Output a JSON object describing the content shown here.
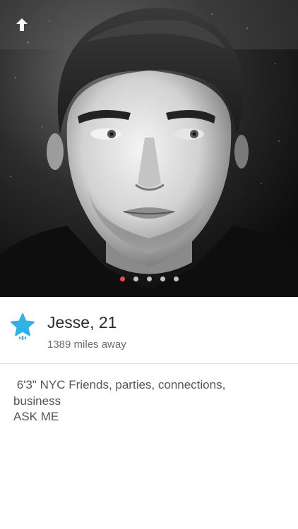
{
  "profile": {
    "name": "Jesse",
    "age_text": ", 21",
    "distance": "1389 miles away",
    "bio": {
      "line1": " 6'3\" NYC Friends, parties, connections,",
      "line2": "business",
      "line3": "ASK ME"
    }
  },
  "photos": {
    "count": 5,
    "active_index": 0
  },
  "colors": {
    "accent_dot": "#f5484e",
    "superlike_star": "#2fb2e5",
    "text_primary": "#2b2b2b",
    "text_secondary": "#6d6d6d"
  },
  "icons": {
    "back": "up-arrow-icon",
    "badge": "superlike-star-icon"
  }
}
